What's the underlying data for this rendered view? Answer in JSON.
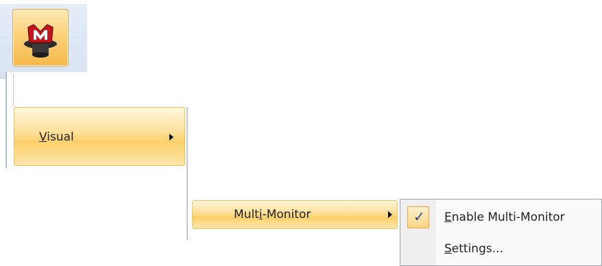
{
  "app": {
    "logo_icon": "m-hat-logo-icon"
  },
  "menu": {
    "visual": {
      "accel": "V",
      "rest": "isual"
    },
    "multi_monitor": {
      "pre": "Mult",
      "accel": "i",
      "rest": "-Monitor"
    },
    "submenu": {
      "enable": {
        "checked_glyph": "✓",
        "accel": "E",
        "rest": "nable Multi-Monitor"
      },
      "settings": {
        "accel": "S",
        "rest": "ettings..."
      }
    }
  },
  "colors": {
    "highlight_top": "#fff6dc",
    "highlight_mid": "#fbd06a",
    "highlight_border": "#f1c15f",
    "check_color": "#2d3f8c"
  }
}
